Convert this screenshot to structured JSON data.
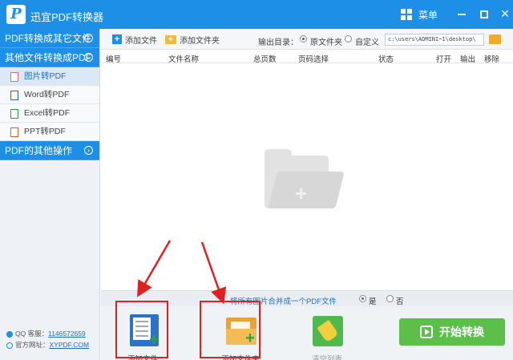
{
  "app": {
    "logo_letter": "P",
    "title": "迅宜PDF转换器",
    "menu_label": "菜单"
  },
  "window_controls": {
    "close": "✕"
  },
  "sidebar": {
    "sections": [
      {
        "label": "PDF转换成其它文件"
      },
      {
        "label": "其他文件转换成PDF"
      }
    ],
    "items": [
      {
        "label": "图片转PDF",
        "icon": "image-file-icon",
        "active": true
      },
      {
        "label": "Word转PDF",
        "icon": "word-file-icon"
      },
      {
        "label": "Excel转PDF",
        "icon": "excel-file-icon"
      },
      {
        "label": "PPT转PDF",
        "icon": "ppt-file-icon"
      }
    ],
    "other_section": {
      "label": "PDF的其他操作"
    },
    "footer": {
      "qq_label": "QQ 客服：",
      "qq_value": "1146572659",
      "site_label": "官方网址：",
      "site_value": "XYPDF.COM"
    }
  },
  "toolbar": {
    "add_file": "添加文件",
    "add_folder": "添加文件夹",
    "output_label": "输出目录：",
    "output_options": [
      {
        "label": "原文件夹",
        "selected": true
      },
      {
        "label": "自定义",
        "selected": false
      }
    ],
    "output_path": "c:\\users\\ADMINI~1\\desktop\\"
  },
  "table": {
    "columns": [
      "编号",
      "文件名称",
      "总页数",
      "页码选择",
      "状态",
      "打开",
      "输出",
      "移除"
    ],
    "rows": []
  },
  "merge": {
    "label": "将所有图片合并成一个PDF文件",
    "yes": "是",
    "no": "否",
    "selected": "yes"
  },
  "actions": {
    "add_file": "添加文件",
    "add_folder": "添加文件夹",
    "clear_list": "清空列表",
    "start": "开始转换"
  },
  "colors": {
    "accent": "#1e8fe6",
    "start": "#5cbf4a",
    "annotation": "#e02020"
  }
}
